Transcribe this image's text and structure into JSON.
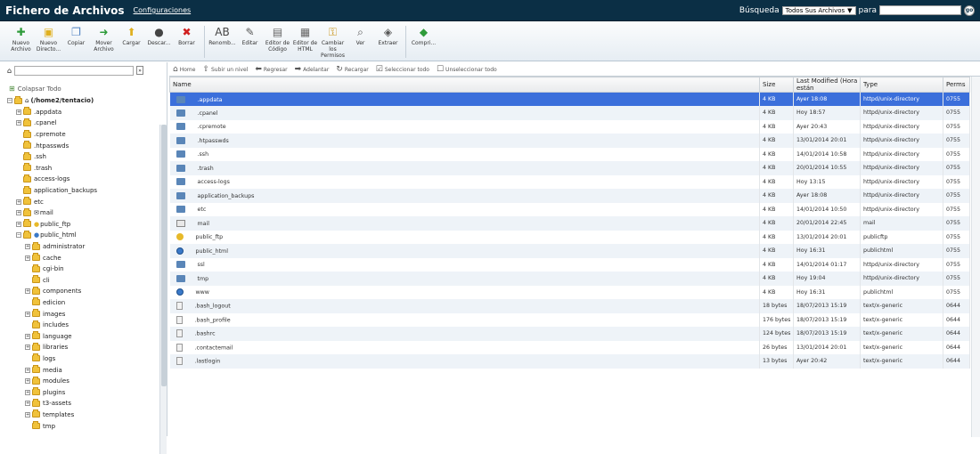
{
  "header": {
    "title": "Fichero de Archivos",
    "config_link": "Configuraciones",
    "search_label": "Búsqueda",
    "search_scope": "Todos Sus Archivos",
    "search_for": "para",
    "search_go": "go"
  },
  "toolbar": [
    {
      "label": "Nuevo Archivo",
      "icon": "new-file-icon",
      "glyph": "✚",
      "color": "#2e9b3a"
    },
    {
      "label": "Nuevo Directo...",
      "icon": "new-folder-icon",
      "glyph": "▣",
      "color": "#e0b020"
    },
    {
      "label": "Copiar",
      "icon": "copy-icon",
      "glyph": "❐",
      "color": "#4b7fc0"
    },
    {
      "label": "Mover Archivo",
      "icon": "move-file-icon",
      "glyph": "➜",
      "color": "#2e9b3a"
    },
    {
      "label": "Cargar",
      "icon": "upload-icon",
      "glyph": "⬆",
      "color": "#e0b020"
    },
    {
      "label": "Descar...",
      "icon": "download-icon",
      "glyph": "●",
      "color": "#444"
    },
    {
      "label": "Borrar",
      "icon": "delete-icon",
      "glyph": "✖",
      "color": "#d02020"
    },
    {
      "label": "Renomb...",
      "icon": "rename-icon",
      "glyph": "AB",
      "color": "#444"
    },
    {
      "label": "Editar",
      "icon": "edit-icon",
      "glyph": "✎",
      "color": "#555"
    },
    {
      "label": "Editor de Código",
      "icon": "code-editor-icon",
      "glyph": "▤",
      "color": "#666"
    },
    {
      "label": "Editor de HTML",
      "icon": "html-editor-icon",
      "glyph": "▦",
      "color": "#666"
    },
    {
      "label": "Cambiar los Permisos",
      "icon": "permissions-icon",
      "glyph": "⚿",
      "color": "#c9951a"
    },
    {
      "label": "Ver",
      "icon": "view-icon",
      "glyph": "⌕",
      "color": "#555"
    },
    {
      "label": "Extraer",
      "icon": "extract-icon",
      "glyph": "◈",
      "color": "#555"
    },
    {
      "label": "Compri...",
      "icon": "compress-icon",
      "glyph": "◆",
      "color": "#2e9b3a"
    }
  ],
  "tree": {
    "collapse_all": "Colapsar Todo",
    "root": "(/home2/tentacio)",
    "items": [
      {
        "label": ".appdata",
        "level": 1,
        "expandable": true
      },
      {
        "label": ".cpanel",
        "level": 1,
        "expandable": true
      },
      {
        "label": ".cpremote",
        "level": 1,
        "expandable": false
      },
      {
        "label": ".htpasswds",
        "level": 1,
        "expandable": false
      },
      {
        "label": ".ssh",
        "level": 1,
        "expandable": false
      },
      {
        "label": ".trash",
        "level": 1,
        "expandable": false
      },
      {
        "label": "access-logs",
        "level": 1,
        "expandable": false
      },
      {
        "label": "application_backups",
        "level": 1,
        "expandable": false
      },
      {
        "label": "etc",
        "level": 1,
        "expandable": true
      },
      {
        "label": "mail",
        "level": 1,
        "expandable": true
      },
      {
        "label": "public_ftp",
        "level": 1,
        "expandable": true
      },
      {
        "label": "public_html",
        "level": 1,
        "expandable": true,
        "open": true
      },
      {
        "label": "administrator",
        "level": 2,
        "expandable": true
      },
      {
        "label": "cache",
        "level": 2,
        "expandable": true
      },
      {
        "label": "cgi-bin",
        "level": 2,
        "expandable": false
      },
      {
        "label": "cli",
        "level": 2,
        "expandable": false
      },
      {
        "label": "components",
        "level": 2,
        "expandable": true
      },
      {
        "label": "edicion",
        "level": 2,
        "expandable": false
      },
      {
        "label": "images",
        "level": 2,
        "expandable": true
      },
      {
        "label": "includes",
        "level": 2,
        "expandable": false
      },
      {
        "label": "language",
        "level": 2,
        "expandable": true
      },
      {
        "label": "libraries",
        "level": 2,
        "expandable": true
      },
      {
        "label": "logs",
        "level": 2,
        "expandable": false
      },
      {
        "label": "media",
        "level": 2,
        "expandable": true
      },
      {
        "label": "modules",
        "level": 2,
        "expandable": true
      },
      {
        "label": "plugins",
        "level": 2,
        "expandable": true
      },
      {
        "label": "t3-assets",
        "level": 2,
        "expandable": true
      },
      {
        "label": "templates",
        "level": 2,
        "expandable": true
      },
      {
        "label": "tmp",
        "level": 2,
        "expandable": false
      }
    ]
  },
  "actions": [
    {
      "label": "Home",
      "icon": "home-icon",
      "glyph": "⌂"
    },
    {
      "label": "Subir un nivel",
      "icon": "up-level-icon",
      "glyph": "⇧"
    },
    {
      "label": "Regresar",
      "icon": "back-icon",
      "glyph": "⬅"
    },
    {
      "label": "Adelantar",
      "icon": "forward-icon",
      "glyph": "➡"
    },
    {
      "label": "Recargar",
      "icon": "reload-icon",
      "glyph": "↻"
    },
    {
      "label": "Seleccionar todo",
      "icon": "select-all-icon",
      "glyph": "☑"
    },
    {
      "label": "Unseleccionar todo",
      "icon": "unselect-all-icon",
      "glyph": "☐"
    }
  ],
  "columns": [
    "Name",
    "Size",
    "Last Modified (Hora están",
    "Type",
    "Perms"
  ],
  "files": [
    {
      "icon": "dir",
      "name": ".appdata",
      "size": "4 KB",
      "modified": "Ayer 18:08",
      "type": "httpd/unix-directory",
      "perms": "0755",
      "selected": true
    },
    {
      "icon": "dir",
      "name": ".cpanel",
      "size": "4 KB",
      "modified": "Hoy 18:57",
      "type": "httpd/unix-directory",
      "perms": "0755"
    },
    {
      "icon": "dir",
      "name": ".cpremote",
      "size": "4 KB",
      "modified": "Ayer 20:43",
      "type": "httpd/unix-directory",
      "perms": "0755"
    },
    {
      "icon": "dir",
      "name": ".htpasswds",
      "size": "4 KB",
      "modified": "13/01/2014 20:01",
      "type": "httpd/unix-directory",
      "perms": "0755"
    },
    {
      "icon": "dir",
      "name": ".ssh",
      "size": "4 KB",
      "modified": "14/01/2014 10:58",
      "type": "httpd/unix-directory",
      "perms": "0755"
    },
    {
      "icon": "dir",
      "name": ".trash",
      "size": "4 KB",
      "modified": "20/01/2014 10:55",
      "type": "httpd/unix-directory",
      "perms": "0755"
    },
    {
      "icon": "dir",
      "name": "access-logs",
      "size": "4 KB",
      "modified": "Hoy 13:15",
      "type": "httpd/unix-directory",
      "perms": "0755"
    },
    {
      "icon": "dir",
      "name": "application_backups",
      "size": "4 KB",
      "modified": "Ayer 18:08",
      "type": "httpd/unix-directory",
      "perms": "0755"
    },
    {
      "icon": "dir",
      "name": "etc",
      "size": "4 KB",
      "modified": "14/01/2014 10:50",
      "type": "httpd/unix-directory",
      "perms": "0755"
    },
    {
      "icon": "mail",
      "name": "mail",
      "size": "4 KB",
      "modified": "20/01/2014 22:45",
      "type": "mail",
      "perms": "0755"
    },
    {
      "icon": "ftp",
      "name": "public_ftp",
      "size": "4 KB",
      "modified": "13/01/2014 20:01",
      "type": "publicftp",
      "perms": "0755"
    },
    {
      "icon": "web",
      "name": "public_html",
      "size": "4 KB",
      "modified": "Hoy 16:31",
      "type": "publichtml",
      "perms": "0755"
    },
    {
      "icon": "dir",
      "name": "ssl",
      "size": "4 KB",
      "modified": "14/01/2014 01:17",
      "type": "httpd/unix-directory",
      "perms": "0755"
    },
    {
      "icon": "dir",
      "name": "tmp",
      "size": "4 KB",
      "modified": "Hoy 19:04",
      "type": "httpd/unix-directory",
      "perms": "0755"
    },
    {
      "icon": "web",
      "name": "www",
      "size": "4 KB",
      "modified": "Hoy 16:31",
      "type": "publichtml",
      "perms": "0755"
    },
    {
      "icon": "text",
      "name": ".bash_logout",
      "size": "18 bytes",
      "modified": "18/07/2013 15:19",
      "type": "text/x-generic",
      "perms": "0644"
    },
    {
      "icon": "text",
      "name": ".bash_profile",
      "size": "176 bytes",
      "modified": "18/07/2013 15:19",
      "type": "text/x-generic",
      "perms": "0644"
    },
    {
      "icon": "text",
      "name": ".bashrc",
      "size": "124 bytes",
      "modified": "18/07/2013 15:19",
      "type": "text/x-generic",
      "perms": "0644"
    },
    {
      "icon": "text",
      "name": ".contactemail",
      "size": "26 bytes",
      "modified": "13/01/2014 20:01",
      "type": "text/x-generic",
      "perms": "0644"
    },
    {
      "icon": "text",
      "name": ".lastlogin",
      "size": "13 bytes",
      "modified": "Ayer 20:42",
      "type": "text/x-generic",
      "perms": "0644"
    }
  ]
}
